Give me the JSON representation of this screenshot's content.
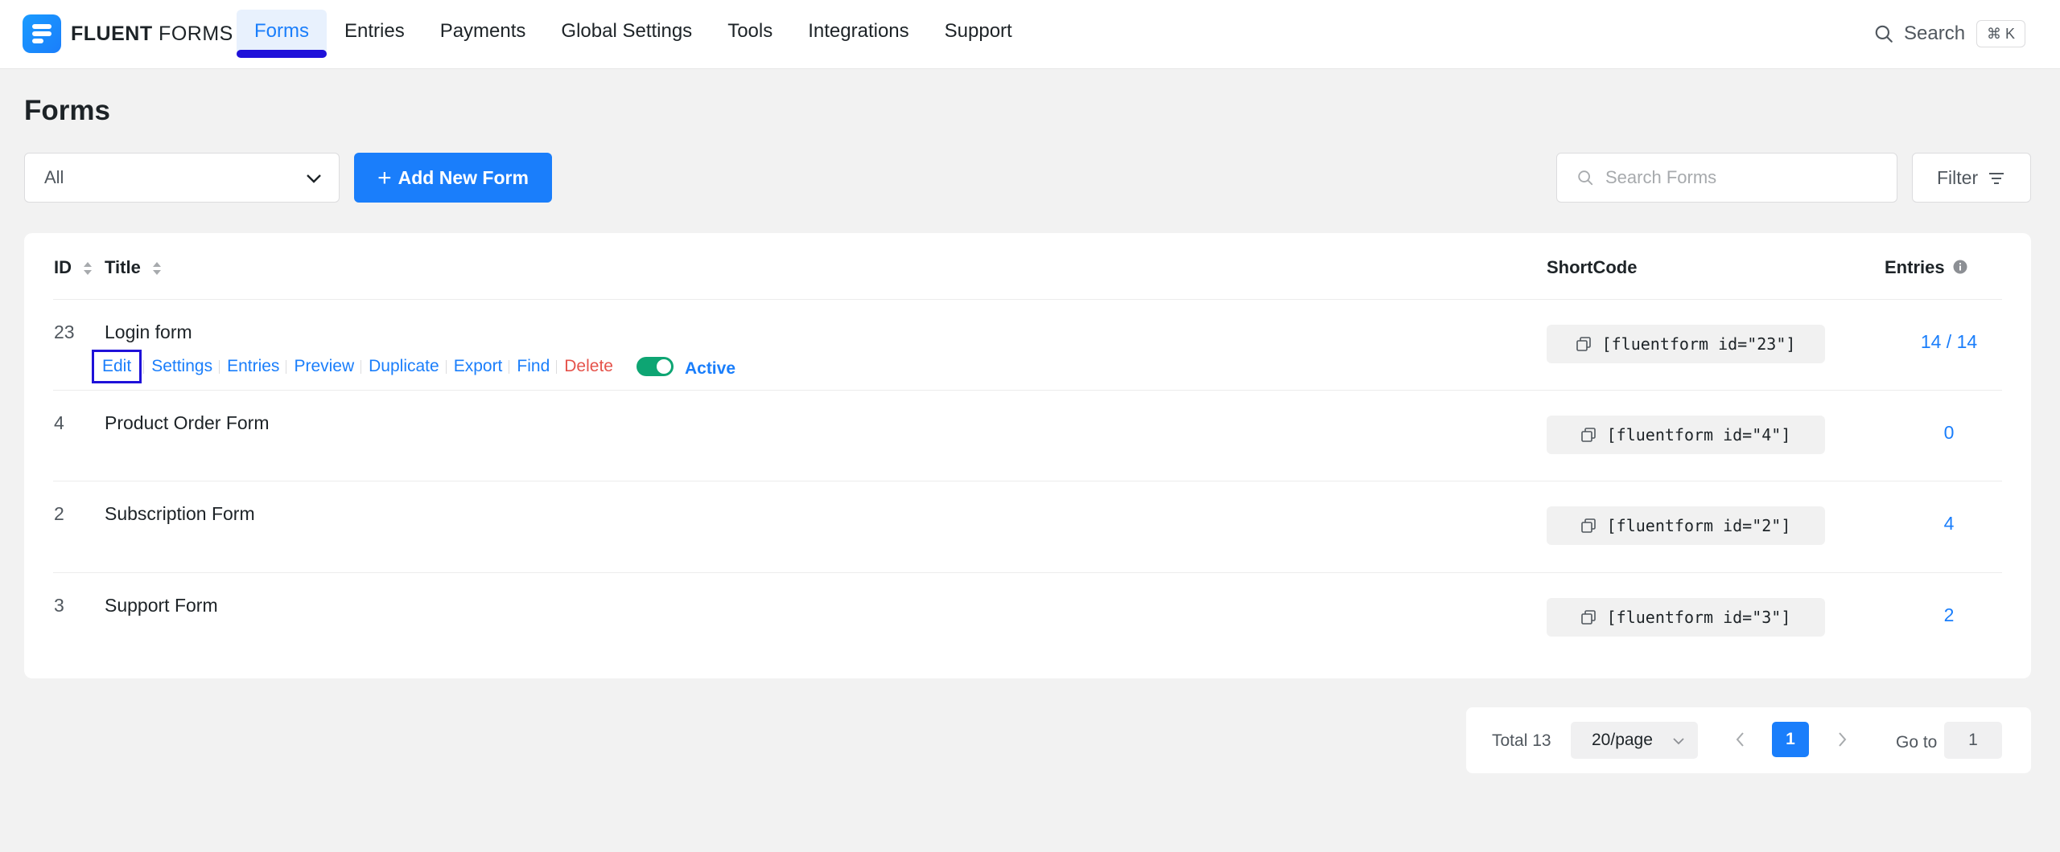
{
  "brand": {
    "name_bold": "FLUENT",
    "name_light": " FORMS"
  },
  "nav": {
    "items": [
      "Forms",
      "Entries",
      "Payments",
      "Global Settings",
      "Tools",
      "Integrations",
      "Support"
    ],
    "search_label": "Search",
    "search_shortcut": "⌘ K"
  },
  "page": {
    "title": "Forms"
  },
  "toolbar": {
    "status_select": "All",
    "add_button": "Add New Form",
    "search_placeholder": "Search Forms",
    "filter_label": "Filter"
  },
  "table": {
    "headers": {
      "id": "ID",
      "title": "Title",
      "shortcode": "ShortCode",
      "entries": "Entries"
    },
    "actions": [
      "Edit",
      "Settings",
      "Entries",
      "Preview",
      "Duplicate",
      "Export",
      "Find",
      "Delete"
    ],
    "status_label": "Active",
    "rows": [
      {
        "id": "23",
        "title": "Login form",
        "shortcode": "[fluentform id=\"23\"]",
        "entries": "14 / 14"
      },
      {
        "id": "4",
        "title": "Product Order Form",
        "shortcode": "[fluentform id=\"4\"]",
        "entries": "0"
      },
      {
        "id": "2",
        "title": "Subscription Form",
        "shortcode": "[fluentform id=\"2\"]",
        "entries": "4"
      },
      {
        "id": "3",
        "title": "Support Form",
        "shortcode": "[fluentform id=\"3\"]",
        "entries": "2"
      }
    ]
  },
  "pagination": {
    "total": "Total 13",
    "page_size": "20/page",
    "current_page": "1",
    "goto_label": "Go to",
    "goto_value": "1"
  },
  "colors": {
    "accent": "#1a7efb",
    "danger": "#e5534b",
    "success": "#0ea573",
    "highlight": "#1f11d9"
  }
}
